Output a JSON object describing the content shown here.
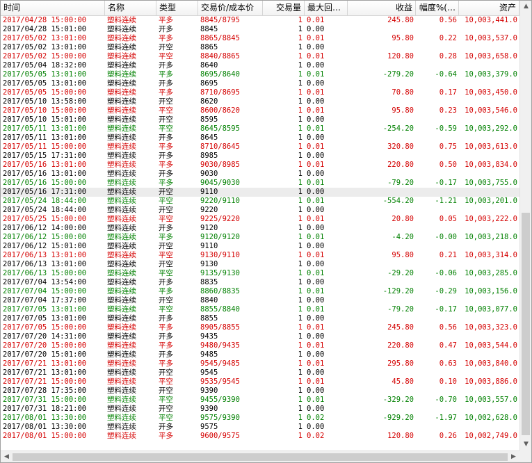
{
  "columns": [
    "时间",
    "名称",
    "类型",
    "交易价/成本价",
    "交易量",
    "最大回…",
    "收益",
    "幅度%(…",
    "资产"
  ],
  "rows": [
    {
      "c": "red",
      "v": [
        "2017/04/28 15:00:00",
        "塑料连续",
        "平多",
        "8845/8795",
        "1",
        "0.01",
        "245.80",
        "0.56",
        "10,003,441.0"
      ]
    },
    {
      "c": "black",
      "v": [
        "2017/04/28 15:01:00",
        "塑料连续",
        "开多",
        "8845",
        "1",
        "0.00",
        "",
        "",
        ""
      ]
    },
    {
      "c": "red",
      "v": [
        "2017/05/02 13:01:00",
        "塑料连续",
        "平多",
        "8865/8845",
        "1",
        "0.01",
        "95.80",
        "0.22",
        "10,003,537.0"
      ]
    },
    {
      "c": "black",
      "v": [
        "2017/05/02 13:01:00",
        "塑料连续",
        "开空",
        "8865",
        "1",
        "0.00",
        "",
        "",
        ""
      ]
    },
    {
      "c": "red",
      "v": [
        "2017/05/02 15:00:00",
        "塑料连续",
        "平空",
        "8840/8865",
        "1",
        "0.01",
        "120.80",
        "0.28",
        "10,003,658.0"
      ]
    },
    {
      "c": "black",
      "v": [
        "2017/05/04 18:32:00",
        "塑料连续",
        "开多",
        "8640",
        "1",
        "0.00",
        "",
        "",
        ""
      ]
    },
    {
      "c": "green",
      "v": [
        "2017/05/05 13:01:00",
        "塑料连续",
        "平多",
        "8695/8640",
        "1",
        "0.01",
        "-279.20",
        "-0.64",
        "10,003,379.0"
      ]
    },
    {
      "c": "black",
      "v": [
        "2017/05/05 13:01:00",
        "塑料连续",
        "开多",
        "8695",
        "1",
        "0.00",
        "",
        "",
        ""
      ]
    },
    {
      "c": "red",
      "v": [
        "2017/05/05 15:00:00",
        "塑料连续",
        "平多",
        "8710/8695",
        "1",
        "0.01",
        "70.80",
        "0.17",
        "10,003,450.0"
      ]
    },
    {
      "c": "black",
      "v": [
        "2017/05/10 13:58:00",
        "塑料连续",
        "开空",
        "8620",
        "1",
        "0.00",
        "",
        "",
        ""
      ]
    },
    {
      "c": "red",
      "v": [
        "2017/05/10 15:00:00",
        "塑料连续",
        "平空",
        "8600/8620",
        "1",
        "0.01",
        "95.80",
        "0.23",
        "10,003,546.0"
      ]
    },
    {
      "c": "black",
      "v": [
        "2017/05/10 15:01:00",
        "塑料连续",
        "开空",
        "8595",
        "1",
        "0.00",
        "",
        "",
        ""
      ]
    },
    {
      "c": "green",
      "v": [
        "2017/05/11 13:01:00",
        "塑料连续",
        "平空",
        "8645/8595",
        "1",
        "0.01",
        "-254.20",
        "-0.59",
        "10,003,292.0"
      ]
    },
    {
      "c": "black",
      "v": [
        "2017/05/11 13:01:00",
        "塑料连续",
        "开多",
        "8645",
        "1",
        "0.00",
        "",
        "",
        ""
      ]
    },
    {
      "c": "red",
      "v": [
        "2017/05/11 15:00:00",
        "塑料连续",
        "平多",
        "8710/8645",
        "1",
        "0.01",
        "320.80",
        "0.75",
        "10,003,613.0"
      ]
    },
    {
      "c": "black",
      "v": [
        "2017/05/15 17:31:00",
        "塑料连续",
        "开多",
        "8985",
        "1",
        "0.00",
        "",
        "",
        ""
      ]
    },
    {
      "c": "red",
      "v": [
        "2017/05/16 13:01:00",
        "塑料连续",
        "平多",
        "9030/8985",
        "1",
        "0.01",
        "220.80",
        "0.50",
        "10,003,834.0"
      ]
    },
    {
      "c": "black",
      "v": [
        "2017/05/16 13:01:00",
        "塑料连续",
        "开多",
        "9030",
        "1",
        "0.00",
        "",
        "",
        ""
      ]
    },
    {
      "c": "green",
      "v": [
        "2017/05/16 15:00:00",
        "塑料连续",
        "平多",
        "9045/9030",
        "1",
        "0.01",
        "-79.20",
        "-0.17",
        "10,003,755.0"
      ]
    },
    {
      "c": "black",
      "sel": true,
      "v": [
        "2017/05/16 17:31:00",
        "塑料连续",
        "开空",
        "9110",
        "1",
        "0.00",
        "",
        "",
        ""
      ]
    },
    {
      "c": "green",
      "v": [
        "2017/05/24 18:44:00",
        "塑料连续",
        "平空",
        "9220/9110",
        "1",
        "0.01",
        "-554.20",
        "-1.21",
        "10,003,201.0"
      ]
    },
    {
      "c": "black",
      "v": [
        "2017/05/24 18:44:00",
        "塑料连续",
        "开空",
        "9220",
        "1",
        "0.00",
        "",
        "",
        ""
      ]
    },
    {
      "c": "red",
      "v": [
        "2017/05/25 15:00:00",
        "塑料连续",
        "平空",
        "9225/9220",
        "1",
        "0.01",
        "20.80",
        "0.05",
        "10,003,222.0"
      ]
    },
    {
      "c": "black",
      "v": [
        "2017/06/12 14:00:00",
        "塑料连续",
        "开多",
        "9120",
        "1",
        "0.00",
        "",
        "",
        ""
      ]
    },
    {
      "c": "green",
      "v": [
        "2017/06/12 15:00:00",
        "塑料连续",
        "平多",
        "9120/9120",
        "1",
        "0.01",
        "-4.20",
        "-0.00",
        "10,003,218.0"
      ]
    },
    {
      "c": "black",
      "v": [
        "2017/06/12 15:01:00",
        "塑料连续",
        "开空",
        "9110",
        "1",
        "0.00",
        "",
        "",
        ""
      ]
    },
    {
      "c": "red",
      "v": [
        "2017/06/13 13:01:00",
        "塑料连续",
        "平空",
        "9130/9110",
        "1",
        "0.01",
        "95.80",
        "0.21",
        "10,003,314.0"
      ]
    },
    {
      "c": "black",
      "v": [
        "2017/06/13 13:01:00",
        "塑料连续",
        "开空",
        "9130",
        "1",
        "0.00",
        "",
        "",
        ""
      ]
    },
    {
      "c": "green",
      "v": [
        "2017/06/13 15:00:00",
        "塑料连续",
        "平空",
        "9135/9130",
        "1",
        "0.01",
        "-29.20",
        "-0.06",
        "10,003,285.0"
      ]
    },
    {
      "c": "black",
      "v": [
        "2017/07/04 13:54:00",
        "塑料连续",
        "开多",
        "8835",
        "1",
        "0.00",
        "",
        "",
        ""
      ]
    },
    {
      "c": "green",
      "v": [
        "2017/07/04 15:00:00",
        "塑料连续",
        "平多",
        "8860/8835",
        "1",
        "0.01",
        "-129.20",
        "-0.29",
        "10,003,156.0"
      ]
    },
    {
      "c": "black",
      "v": [
        "2017/07/04 17:37:00",
        "塑料连续",
        "开空",
        "8840",
        "1",
        "0.00",
        "",
        "",
        ""
      ]
    },
    {
      "c": "green",
      "v": [
        "2017/07/05 13:01:00",
        "塑料连续",
        "平空",
        "8855/8840",
        "1",
        "0.01",
        "-79.20",
        "-0.17",
        "10,003,077.0"
      ]
    },
    {
      "c": "black",
      "v": [
        "2017/07/05 13:01:00",
        "塑料连续",
        "开多",
        "8855",
        "1",
        "0.00",
        "",
        "",
        ""
      ]
    },
    {
      "c": "red",
      "v": [
        "2017/07/05 15:00:00",
        "塑料连续",
        "平多",
        "8905/8855",
        "1",
        "0.01",
        "245.80",
        "0.56",
        "10,003,323.0"
      ]
    },
    {
      "c": "black",
      "v": [
        "2017/07/20 14:31:00",
        "塑料连续",
        "开多",
        "9435",
        "1",
        "0.00",
        "",
        "",
        ""
      ]
    },
    {
      "c": "red",
      "v": [
        "2017/07/20 15:00:00",
        "塑料连续",
        "平多",
        "9480/9435",
        "1",
        "0.01",
        "220.80",
        "0.47",
        "10,003,544.0"
      ]
    },
    {
      "c": "black",
      "v": [
        "2017/07/20 15:01:00",
        "塑料连续",
        "开多",
        "9485",
        "1",
        "0.00",
        "",
        "",
        ""
      ]
    },
    {
      "c": "red",
      "v": [
        "2017/07/21 13:01:00",
        "塑料连续",
        "平多",
        "9545/9485",
        "1",
        "0.01",
        "295.80",
        "0.63",
        "10,003,840.0"
      ]
    },
    {
      "c": "black",
      "v": [
        "2017/07/21 13:01:00",
        "塑料连续",
        "开空",
        "9545",
        "1",
        "0.00",
        "",
        "",
        ""
      ]
    },
    {
      "c": "red",
      "v": [
        "2017/07/21 15:00:00",
        "塑料连续",
        "平空",
        "9535/9545",
        "1",
        "0.01",
        "45.80",
        "0.10",
        "10,003,886.0"
      ]
    },
    {
      "c": "black",
      "v": [
        "2017/07/28 17:35:00",
        "塑料连续",
        "开空",
        "9390",
        "1",
        "0.00",
        "",
        "",
        ""
      ]
    },
    {
      "c": "green",
      "v": [
        "2017/07/31 15:00:00",
        "塑料连续",
        "平空",
        "9455/9390",
        "1",
        "0.01",
        "-329.20",
        "-0.70",
        "10,003,557.0"
      ]
    },
    {
      "c": "black",
      "v": [
        "2017/07/31 18:21:00",
        "塑料连续",
        "开空",
        "9390",
        "1",
        "0.00",
        "",
        "",
        ""
      ]
    },
    {
      "c": "green",
      "v": [
        "2017/08/01 13:30:00",
        "塑料连续",
        "平空",
        "9575/9390",
        "1",
        "0.02",
        "-929.20",
        "-1.97",
        "10,002,628.0"
      ]
    },
    {
      "c": "black",
      "v": [
        "2017/08/01 13:30:00",
        "塑料连续",
        "开多",
        "9575",
        "1",
        "0.00",
        "",
        "",
        ""
      ]
    },
    {
      "c": "red",
      "v": [
        "2017/08/01 15:00:00",
        "塑料连续",
        "平多",
        "9600/9575",
        "1",
        "0.02",
        "120.80",
        "0.26",
        "10,002,749.0"
      ]
    }
  ],
  "colors": {
    "profit": "#d40000",
    "loss": "#008000",
    "neutral": "#000000"
  },
  "icons": {
    "scroll_up": "triangle-up-icon",
    "scroll_down": "triangle-down-icon",
    "scroll_left": "triangle-left-icon",
    "scroll_right": "triangle-right-icon"
  }
}
